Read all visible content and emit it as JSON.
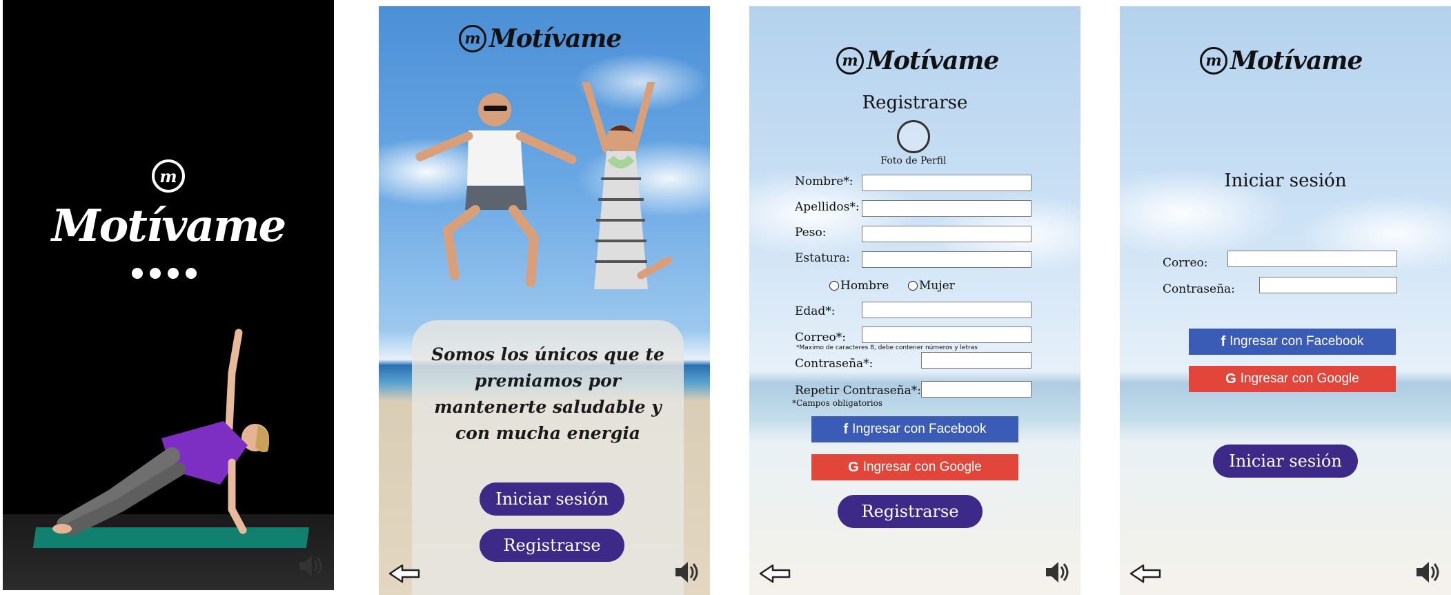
{
  "brand": {
    "mark": "m",
    "name": "Motívame"
  },
  "splash": {
    "loading_dots": 4
  },
  "welcome": {
    "tagline": "Somos los únicos que te premiamos por mantenerte saludable y con mucha energia",
    "login_button": "Iniciar sesión",
    "register_button": "Registrarse"
  },
  "register": {
    "title": "Registrarse",
    "photo_label": "Foto de Perfil",
    "fields": {
      "nombre": "Nombre*:",
      "apellidos": "Apellidos*:",
      "peso": "Peso:",
      "estatura": "Estatura:",
      "edad": "Edad*:",
      "correo": "Correo*:",
      "contrasena": "Contraseña*:",
      "repetir": "Repetir Contraseña*:"
    },
    "gender": {
      "male": "Hombre",
      "female": "Mujer"
    },
    "password_hint": "*Maximo de caracteres 8, debe contener números y letras",
    "required_note": "*Campos obligatorios",
    "facebook_button": "Ingresar con Facebook",
    "google_button": "Ingresar con Google",
    "submit_button": "Registrarse"
  },
  "login": {
    "title": "Iniciar sesión",
    "correo": "Correo:",
    "contrasena": "Contraseña:",
    "facebook_button": "Ingresar con Facebook",
    "google_button": "Ingresar con Google",
    "submit_button": "Iniciar sesión"
  },
  "icons": {
    "back": "back-arrow-icon",
    "sound": "speaker-icon",
    "facebook": "f",
    "google": "G"
  },
  "colors": {
    "accent": "#3d2a88",
    "facebook": "#3a5bb6",
    "google": "#e2463a"
  }
}
